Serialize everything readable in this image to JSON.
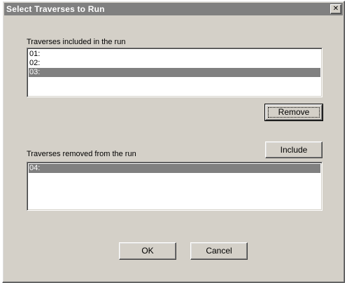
{
  "dialog": {
    "title": "Select Traverses to Run",
    "close_glyph": "✕"
  },
  "included": {
    "label": "Traverses included in the run",
    "items": [
      {
        "label": "01:",
        "selected": false
      },
      {
        "label": "02:",
        "selected": false
      },
      {
        "label": "03:",
        "selected": true
      }
    ]
  },
  "removed": {
    "label": "Traverses removed from the run",
    "items": [
      {
        "label": "04:",
        "selected": true
      }
    ]
  },
  "buttons": {
    "remove": "Remove",
    "include": "Include",
    "ok": "OK",
    "cancel": "Cancel"
  },
  "colors": {
    "face": "#d4d0c8",
    "titlebar": "#808080",
    "selection": "#808080"
  }
}
